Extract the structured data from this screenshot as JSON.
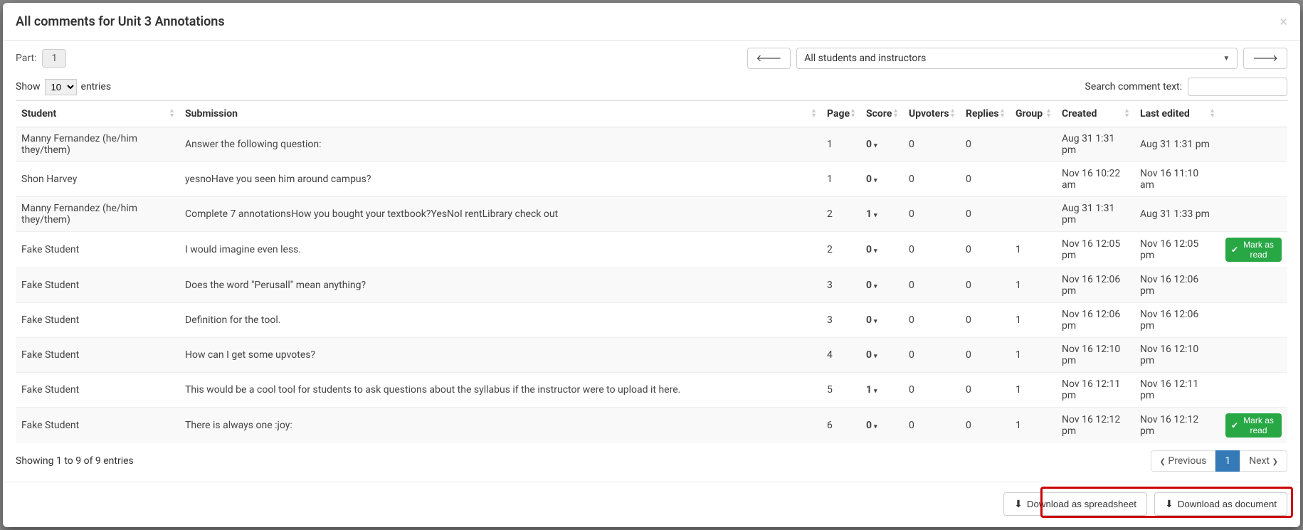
{
  "header": {
    "title": "All comments for Unit 3 Annotations"
  },
  "top": {
    "part_label": "Part:",
    "part_value": "1",
    "filter_value": "All students and instructors"
  },
  "controls": {
    "show_label_prefix": "Show",
    "show_label_suffix": "entries",
    "show_options": [
      "10"
    ],
    "show_selected": "10",
    "search_label": "Search comment text:"
  },
  "columns": {
    "student": "Student",
    "submission": "Submission",
    "page": "Page",
    "score": "Score",
    "upvoters": "Upvoters",
    "replies": "Replies",
    "group": "Group",
    "created": "Created",
    "last_edited": "Last edited"
  },
  "rows": [
    {
      "student": "Manny Fernandez (he/him they/them)",
      "submission": "Answer the following question:",
      "page": "1",
      "score": "0",
      "upvoters": "0",
      "replies": "0",
      "group": "",
      "created": "Aug 31 1:31 pm",
      "edited": "Aug 31 1:31 pm",
      "mark": false
    },
    {
      "student": "Shon Harvey",
      "submission": "yesnoHave you seen him around campus?",
      "page": "1",
      "score": "0",
      "upvoters": "0",
      "replies": "0",
      "group": "",
      "created": "Nov 16 10:22 am",
      "edited": "Nov 16 11:10 am",
      "mark": false
    },
    {
      "student": "Manny Fernandez (he/him they/them)",
      "submission": "Complete 7 annotationsHow you bought your textbook?YesNoI rentLibrary check out",
      "page": "2",
      "score": "1",
      "upvoters": "0",
      "replies": "0",
      "group": "",
      "created": "Aug 31 1:31 pm",
      "edited": "Aug 31 1:33 pm",
      "mark": false
    },
    {
      "student": "Fake Student",
      "submission": "I would imagine even less.",
      "page": "2",
      "score": "0",
      "upvoters": "0",
      "replies": "0",
      "group": "1",
      "created": "Nov 16 12:05 pm",
      "edited": "Nov 16 12:05 pm",
      "mark": true
    },
    {
      "student": "Fake Student",
      "submission": "Does the word \"Perusall\" mean anything?",
      "page": "3",
      "score": "0",
      "upvoters": "0",
      "replies": "0",
      "group": "1",
      "created": "Nov 16 12:06 pm",
      "edited": "Nov 16 12:06 pm",
      "mark": false
    },
    {
      "student": "Fake Student",
      "submission": "Definition for the tool.",
      "page": "3",
      "score": "0",
      "upvoters": "0",
      "replies": "0",
      "group": "1",
      "created": "Nov 16 12:06 pm",
      "edited": "Nov 16 12:06 pm",
      "mark": false
    },
    {
      "student": "Fake Student",
      "submission": "How can I get some upvotes?",
      "page": "4",
      "score": "0",
      "upvoters": "0",
      "replies": "0",
      "group": "1",
      "created": "Nov 16 12:10 pm",
      "edited": "Nov 16 12:10 pm",
      "mark": false
    },
    {
      "student": "Fake Student",
      "submission": "This would be a cool tool for students to ask questions about the syllabus if the instructor were to upload it here.",
      "page": "5",
      "score": "1",
      "upvoters": "0",
      "replies": "0",
      "group": "1",
      "created": "Nov 16 12:11 pm",
      "edited": "Nov 16 12:11 pm",
      "mark": false
    },
    {
      "student": "Fake Student",
      "submission": "There is always one :joy:",
      "page": "6",
      "score": "0",
      "upvoters": "0",
      "replies": "0",
      "group": "1",
      "created": "Nov 16 12:12 pm",
      "edited": "Nov 16 12:12 pm",
      "mark": true
    }
  ],
  "mark_read_label": "Mark as read",
  "footer": {
    "info": "Showing 1 to 9 of 9 entries",
    "prev": "Previous",
    "next": "Next",
    "page": "1"
  },
  "downloads": {
    "spreadsheet": "Download as spreadsheet",
    "document": "Download as document"
  }
}
